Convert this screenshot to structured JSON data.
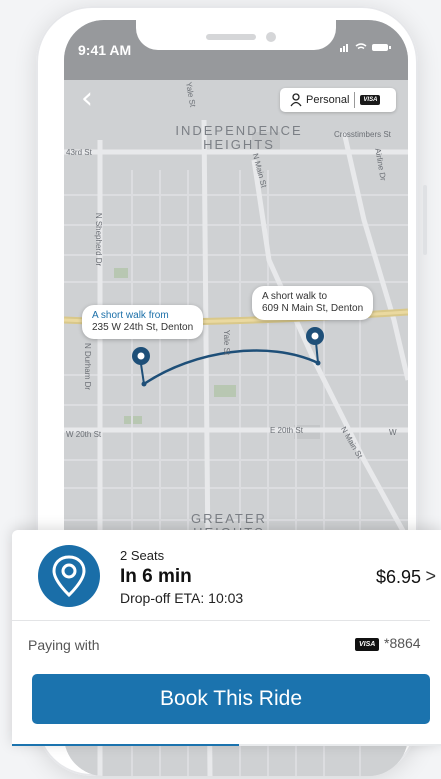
{
  "status_bar": {
    "time": "9:41 AM"
  },
  "header": {
    "back_icon": "chevron-left-icon",
    "profile_label": "Personal",
    "profile_icon": "person-icon",
    "payment_brand": "VISA"
  },
  "map": {
    "neighborhoods": [
      "INDEPENDENCE HEIGHTS",
      "GREATER HEIGHTS"
    ],
    "streets": [
      "43rd St",
      "Yale St",
      "N Main St",
      "Crosstimbers St",
      "Airline Dr",
      "N Shepherd Dr",
      "N Durham Dr",
      "Yale St",
      "W 20th St",
      "E 20th St",
      "N Main St",
      "W"
    ],
    "pickup": {
      "line1": "A short walk from",
      "line2": "235 W 24th St, Denton"
    },
    "dropoff": {
      "line1": "A short walk to",
      "line2": "609 N Main St, Denton"
    }
  },
  "ride_card": {
    "icon": "location-pin-icon",
    "seats": "2 Seats",
    "eta": "In 6 min",
    "dropoff_eta": "Drop-off ETA: 10:03",
    "price": "$6.95",
    "price_chevron": ">",
    "paying_with_label": "Paying with",
    "card_brand": "VISA",
    "card_last4": "*8864",
    "book_label": "Book This Ride",
    "progress_fraction": 0.53
  },
  "colors": {
    "accent": "#1b73ae",
    "route": "#1e4f78"
  }
}
